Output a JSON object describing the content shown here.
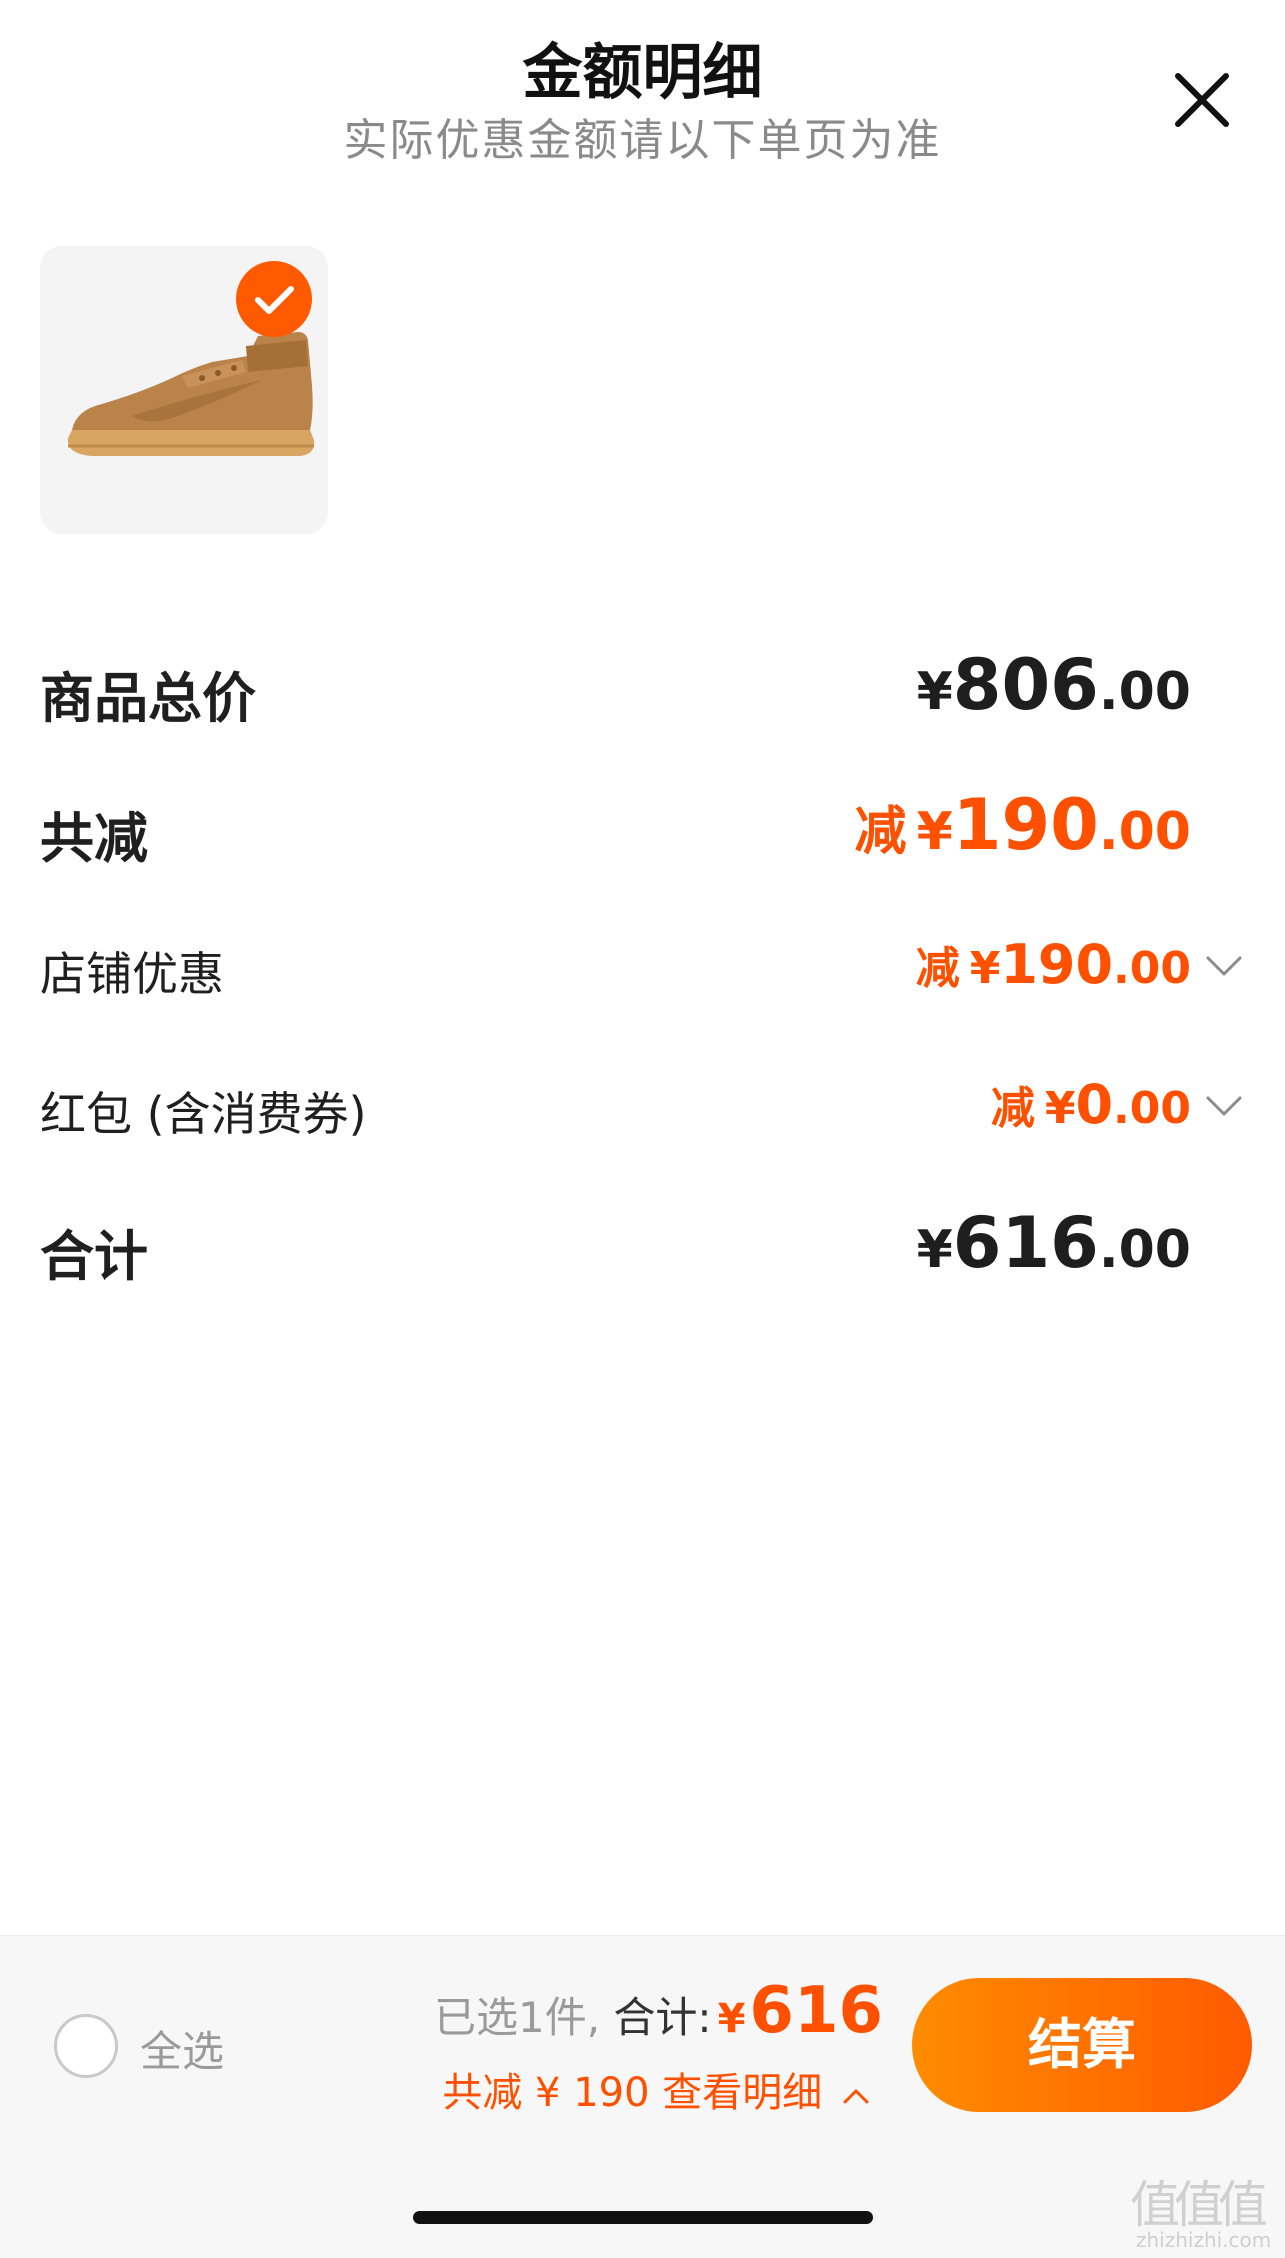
{
  "header": {
    "title": "金额明细",
    "subtitle": "实际优惠金额请以下单页为准",
    "close_icon": "close-icon"
  },
  "product": {
    "image": "sneaker-image",
    "selected": true,
    "check_icon": "check-icon"
  },
  "rows": {
    "total_price": {
      "label": "商品总价",
      "currency": "¥",
      "integer": "806",
      "decimal": ".00"
    },
    "total_reduction": {
      "label": "共减",
      "prefix": "减",
      "currency": "¥",
      "integer": "190",
      "decimal": ".00"
    },
    "store_discount": {
      "label": "店铺优惠",
      "prefix": "减",
      "currency": "¥",
      "integer": "190",
      "decimal": ".00",
      "icon": "chevron-down-icon"
    },
    "red_packet": {
      "label": "红包 (含消费券)",
      "prefix": "减",
      "currency": "¥",
      "integer": "0",
      "decimal": ".00",
      "icon": "chevron-down-icon"
    },
    "subtotal": {
      "label": "合计",
      "currency": "¥",
      "integer": "616",
      "decimal": ".00"
    }
  },
  "bottom_bar": {
    "select_all_label": "全选",
    "selected_count_text": "已选1件,",
    "total_label": "合计:",
    "total_currency": "¥",
    "total_value": "616",
    "detail_text": "共减 ¥ 190  查看明细",
    "detail_icon": "chevron-up-icon",
    "checkout_label": "结算"
  },
  "watermark": {
    "logo_text": "值值值",
    "site_text": "zhizhizhi.com"
  },
  "colors": {
    "accent": "#ff5000",
    "gradient_start": "#ff8c00",
    "gradient_end": "#ff5a00",
    "text_dark": "#1e1e1e",
    "text_muted": "#8a8a8a"
  }
}
